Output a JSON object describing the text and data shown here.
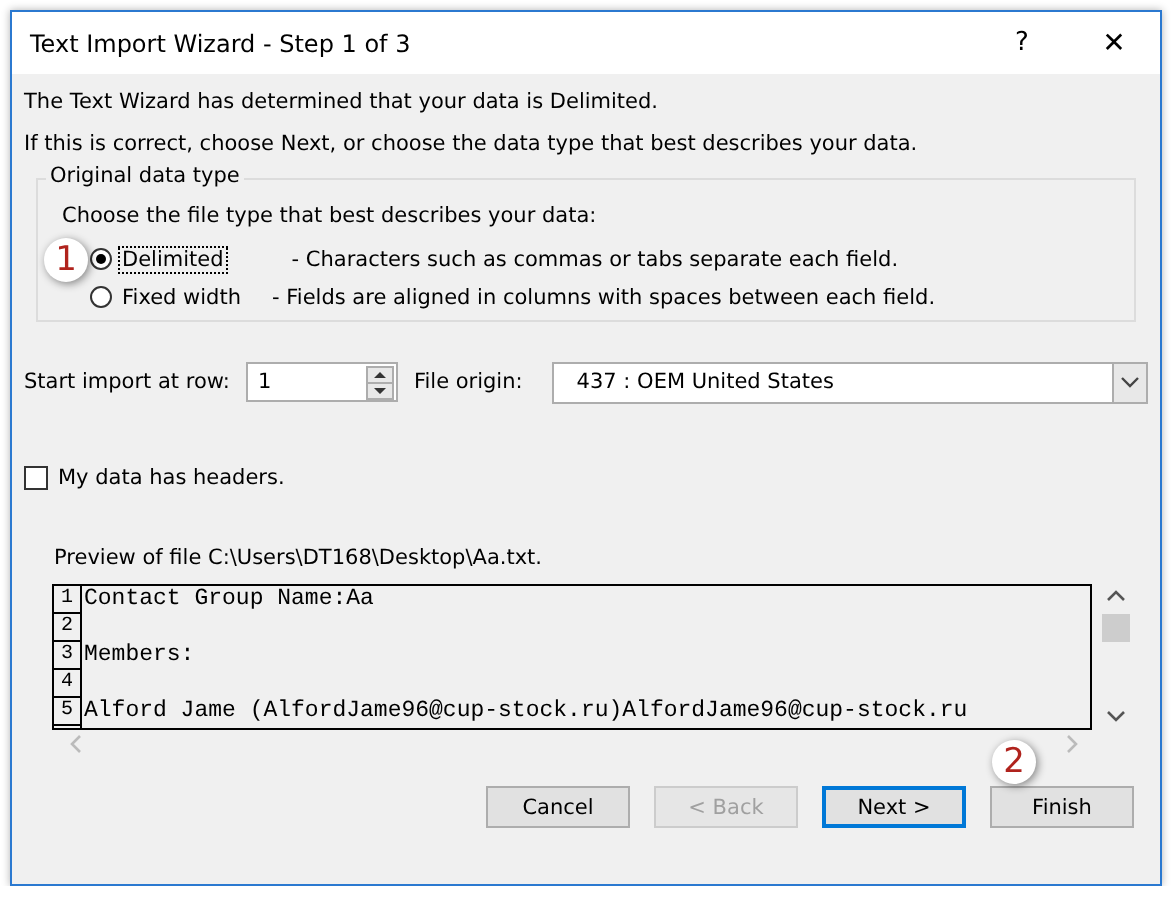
{
  "window": {
    "title": "Text Import Wizard - Step 1 of 3",
    "help": "?",
    "close": "✕"
  },
  "intro": [
    "The Text Wizard has determined that your data is Delimited.",
    "If this is correct, choose Next, or choose the data type that best describes your data."
  ],
  "group": {
    "legend": "Original data type",
    "prompt": "Choose the file type that best describes your data:",
    "options": [
      {
        "label": "Delimited",
        "description": "- Characters such as commas or tabs separate each field.",
        "selected": true,
        "focused": true
      },
      {
        "label": "Fixed width",
        "description": "- Fields are aligned in columns with spaces between each field.",
        "selected": false,
        "focused": false
      }
    ]
  },
  "start_row": {
    "label": "Start import at row:",
    "value": "1"
  },
  "file_origin": {
    "label": "File origin:",
    "value": "437 : OEM United States"
  },
  "headers": {
    "label": "My data has headers.",
    "checked": false
  },
  "preview": {
    "label": "Preview of file C:\\Users\\DT168\\Desktop\\Aa.txt.",
    "lines": [
      {
        "number": "1",
        "text": "Contact Group Name:Aa"
      },
      {
        "number": "2"
      },
      {
        "number": "3",
        "text": "Members:"
      },
      {
        "number": "4"
      },
      {
        "number": "5",
        "text": "Alford Jame (AlfordJame96@cup-stock.ru)AlfordJame96@cup-stock.ru"
      }
    ]
  },
  "buttons": [
    {
      "label": "Cancel",
      "disabled": false,
      "default": false
    },
    {
      "label": "< Back",
      "disabled": true,
      "default": false
    },
    {
      "label": "Next >",
      "disabled": false,
      "default": true
    },
    {
      "label": "Finish",
      "disabled": false,
      "default": false
    }
  ],
  "callouts": [
    {
      "text": "1"
    },
    {
      "text": "2"
    }
  ]
}
